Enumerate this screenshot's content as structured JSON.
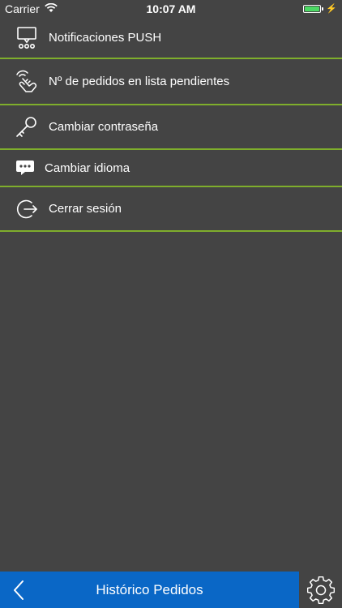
{
  "status_bar": {
    "carrier": "Carrier",
    "time": "10:07 AM",
    "battery_level": 1.0,
    "battery_color": "#4cd964"
  },
  "menu": {
    "items": [
      {
        "label": "Notificaciones PUSH",
        "icon": "push-notification-icon"
      },
      {
        "label": "Nº de pedidos en lista pendientes",
        "icon": "touch-gesture-icon"
      },
      {
        "label": "Cambiar contraseña",
        "icon": "key-icon"
      },
      {
        "label": "Cambiar idioma",
        "icon": "chat-bubble-icon"
      },
      {
        "label": "Cerrar sesión",
        "icon": "logout-icon"
      }
    ],
    "divider_color": "#7fae2c"
  },
  "bottom_bar": {
    "title": "Histórico Pedidos",
    "back_icon": "chevron-left-icon",
    "settings_icon": "gear-icon",
    "accent_color": "#0a67c6"
  }
}
